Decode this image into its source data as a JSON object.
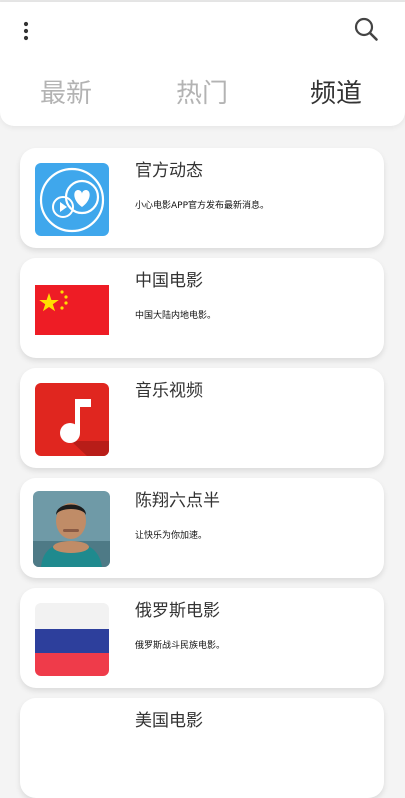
{
  "header": {
    "menu_icon": "more-vertical-icon",
    "search_icon": "search-icon",
    "tabs": [
      {
        "label": "最新",
        "active": false
      },
      {
        "label": "热门",
        "active": false
      },
      {
        "label": "频道",
        "active": true
      }
    ]
  },
  "channels": [
    {
      "title": "官方动态",
      "desc": "小心电影APP官方发布最新消息。",
      "icon": "official-news-logo-icon"
    },
    {
      "title": "中国电影",
      "desc": "中国大陆内地电影。",
      "icon": "china-flag-icon"
    },
    {
      "title": "音乐视频",
      "desc": "",
      "icon": "music-note-icon"
    },
    {
      "title": "陈翔六点半",
      "desc": "让快乐为你加速。",
      "icon": "person-avatar"
    },
    {
      "title": "俄罗斯电影",
      "desc": "俄罗斯战斗民族电影。",
      "icon": "russia-flag-icon"
    },
    {
      "title": "美国电影",
      "desc": "",
      "icon": "usa-flag-icon"
    }
  ],
  "colors": {
    "accent_blue": "#3fa7ec",
    "music_red": "#e0261f",
    "china_red": "#ee1c25",
    "china_star": "#ffde00",
    "russia_blue": "#2d3f9c",
    "russia_red": "#ef3b4a"
  }
}
